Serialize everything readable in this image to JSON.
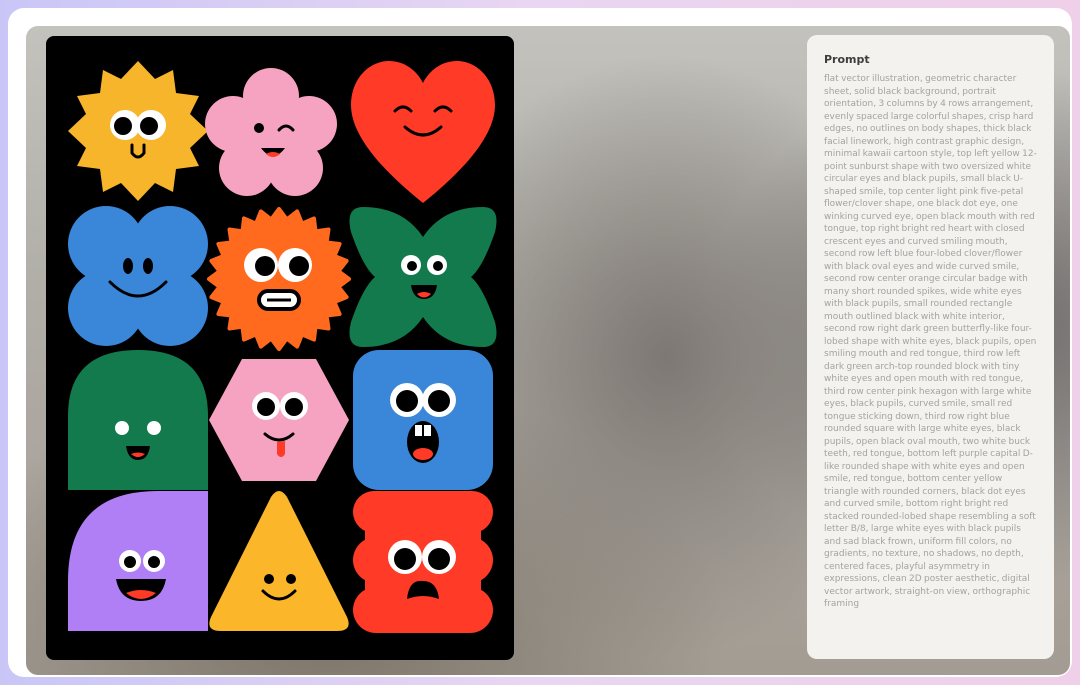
{
  "panel": {
    "title": "Prompt",
    "text": "flat vector illustration, geometric character sheet, solid black background, portrait orientation, 3 columns by 4 rows arrangement, evenly spaced large colorful shapes, crisp hard edges, no outlines on body shapes, thick black facial linework, high contrast graphic design, minimal kawaii cartoon style, top left yellow 12-point sunburst shape with two oversized white circular eyes and black pupils, small black U-shaped smile, top center light pink five-petal flower/clover shape, one black dot eye, one winking curved eye, open black mouth with red tongue, top right bright red heart with closed crescent eyes and curved smiling mouth, second row left blue four-lobed clover/flower with black oval eyes and wide curved smile, second row center orange circular badge with many short rounded spikes, wide white eyes with black pupils, small rounded rectangle mouth outlined black with white interior, second row right dark green butterfly-like four-lobed shape with white eyes, black pupils, open smiling mouth and red tongue, third row left dark green arch-top rounded block with tiny white eyes and open mouth with red tongue, third row center pink hexagon with large white eyes, black pupils, curved smile, small red tongue sticking down, third row right blue rounded square with large white eyes, black pupils, open black oval mouth, two white buck teeth, red tongue, bottom left purple capital D-like rounded shape with white eyes and open smile, red tongue, bottom center yellow triangle with rounded corners, black dot eyes and curved smile, bottom right bright red stacked rounded-lobed shape resembling a soft letter B/8, large white eyes with black pupils and sad black frown, uniform fill colors, no gradients, no texture, no shadows, no depth, centered faces, playful asymmetry in expressions, clean 2D poster aesthetic, digital vector artwork, straight-on view, orthographic framing"
  },
  "artwork": {
    "characters": [
      {
        "shape": "sunburst",
        "color": "#f7b52c"
      },
      {
        "shape": "flower",
        "color": "#f5a3c0"
      },
      {
        "shape": "heart",
        "color": "#ff3a26"
      },
      {
        "shape": "clover",
        "color": "#3a86d8"
      },
      {
        "shape": "spiky-badge",
        "color": "#ff6a1f"
      },
      {
        "shape": "butterfly",
        "color": "#127a4c"
      },
      {
        "shape": "arch",
        "color": "#127a4c"
      },
      {
        "shape": "hexagon",
        "color": "#f5a3c0"
      },
      {
        "shape": "rounded-square",
        "color": "#3a86d8"
      },
      {
        "shape": "d-shape",
        "color": "#b07ff5"
      },
      {
        "shape": "triangle",
        "color": "#fbb62a"
      },
      {
        "shape": "lobed-b",
        "color": "#ff3a26"
      }
    ],
    "colors": {
      "background": "#000000",
      "tongue": "#ff3a26",
      "eye_white": "#ffffff",
      "ink": "#000000"
    }
  }
}
